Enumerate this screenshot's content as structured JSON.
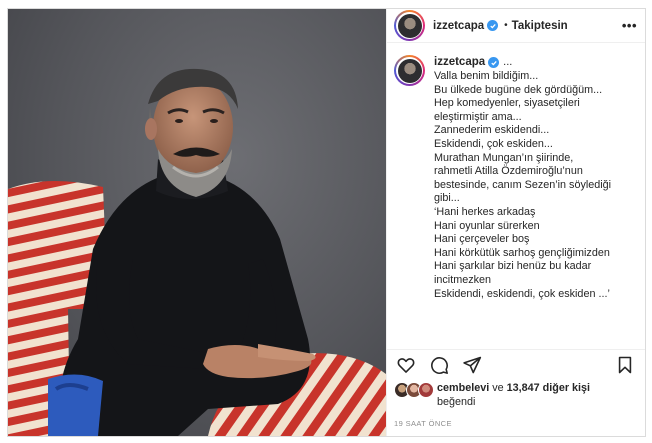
{
  "post": {
    "author": "izzetcapa",
    "follow_status": "Takiptesin",
    "more_label": "•••",
    "caption_ellipsis": "...",
    "caption_lines": [
      "Valla benim bildiğim...",
      "Bu ülkede bugüne dek gördüğüm...",
      "Hep komedyenler, siyasetçileri",
      "eleştirmiştir ama...",
      "Zannederim eskidendi...",
      "Eskidendi, çok eskiden...",
      "Murathan Mungan’ın şiirinde,",
      "rahmetli Atilla Özdemiroğlu’nun",
      "bestesinde, canım Sezen’in söylediği",
      "gibi...",
      "‘Hani herkes arkadaş",
      "Hani oyunlar sürerken",
      "Hani çerçeveler boş",
      "Hani körkütük sarhoş gençliğimizden",
      "Hani şarkılar bizi henüz bu kadar",
      "incitmezken",
      "Eskidendi, eskidendi, çok eskiden ...’"
    ],
    "likes": {
      "first_liker": "cembelevi",
      "connector": " ve ",
      "others": "13,847 diğer kişi",
      "suffix": "beğendi"
    },
    "timestamp": "19 SAAT ÖNCE"
  },
  "icons": {
    "verified": "verified-badge-icon",
    "like": "heart-icon",
    "comment": "comment-icon",
    "share": "paper-plane-icon",
    "save": "bookmark-icon"
  },
  "colors": {
    "verified_blue": "#3897f0",
    "text": "#262626",
    "muted": "#8e8e8e",
    "border": "#dbdbdb",
    "chair_red": "#c8342b",
    "chair_cream": "#f1e2cf"
  }
}
